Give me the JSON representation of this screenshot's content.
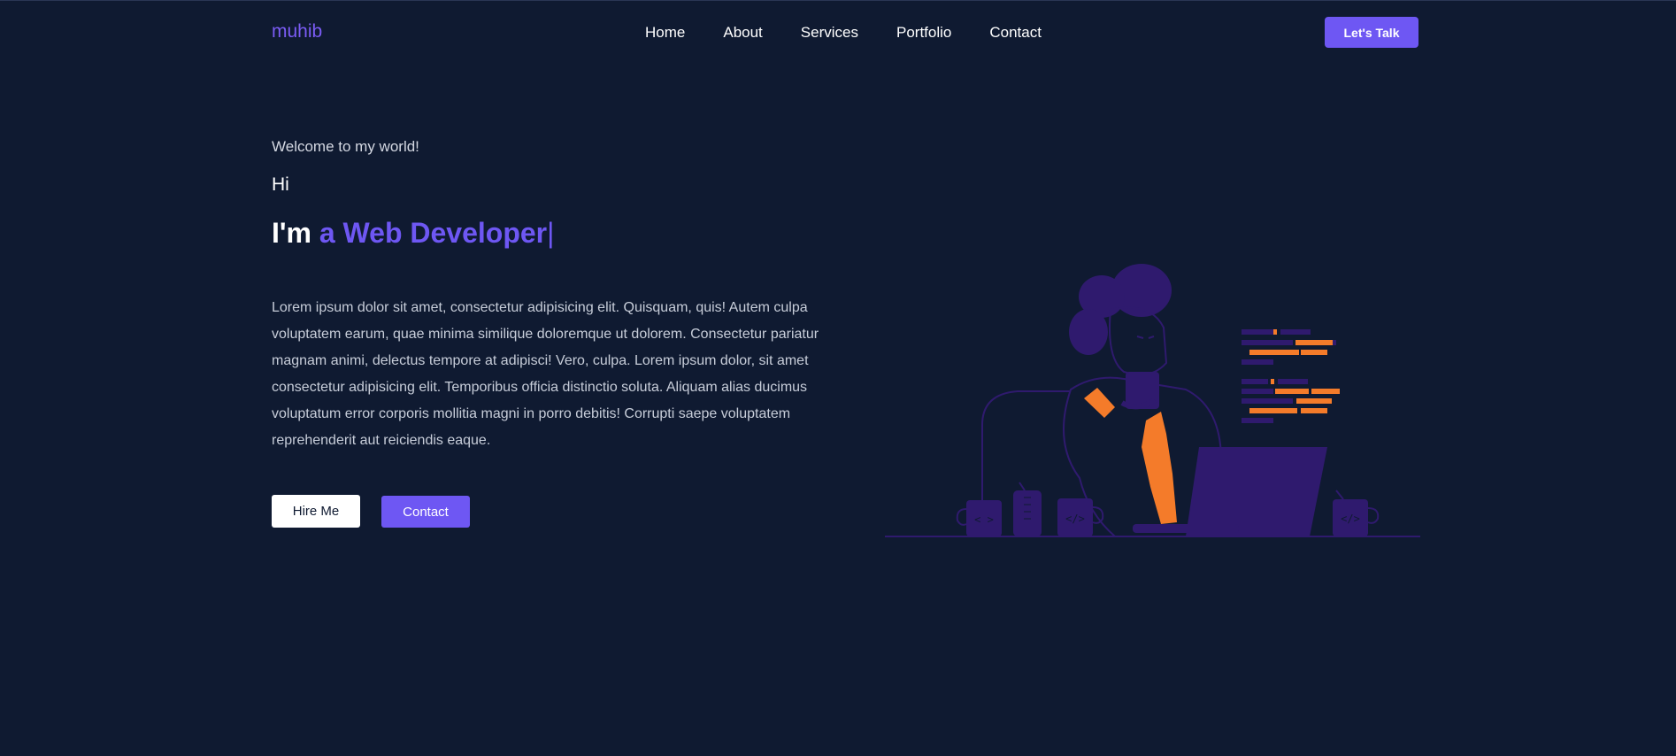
{
  "brand": {
    "logo": "muhib"
  },
  "nav": {
    "items": [
      "Home",
      "About",
      "Services",
      "Portfolio",
      "Contact"
    ],
    "cta": "Let's Talk"
  },
  "hero": {
    "welcome": "Welcome to my world!",
    "greeting": "Hi",
    "headline_prefix": "I'm",
    "headline_role": "a Web Developer",
    "cursor": "|",
    "paragraph": "Lorem ipsum dolor sit amet, consectetur adipisicing elit. Quisquam, quis! Autem culpa voluptatem earum, quae minima similique doloremque ut dolorem. Consectetur pariatur magnam animi, delectus tempore at adipisci! Vero, culpa. Lorem ipsum dolor, sit amet consectetur adipisicing elit. Temporibus officia distinctio soluta. Aliquam alias ducimus voluptatum error corporis mollitia magni in porro debitis! Corrupti saepe voluptatem reprehenderit aut reiciendis eaque.",
    "buttons": {
      "hire": "Hire Me",
      "contact": "Contact"
    }
  },
  "illustration": {
    "mug_labels": [
      "< >",
      "</>",
      "</>"
    ]
  },
  "colors": {
    "background": "#0f1a31",
    "accent": "#6e57f3",
    "illustration_purple": "#2f1a6e",
    "illustration_orange": "#f47b2a"
  }
}
